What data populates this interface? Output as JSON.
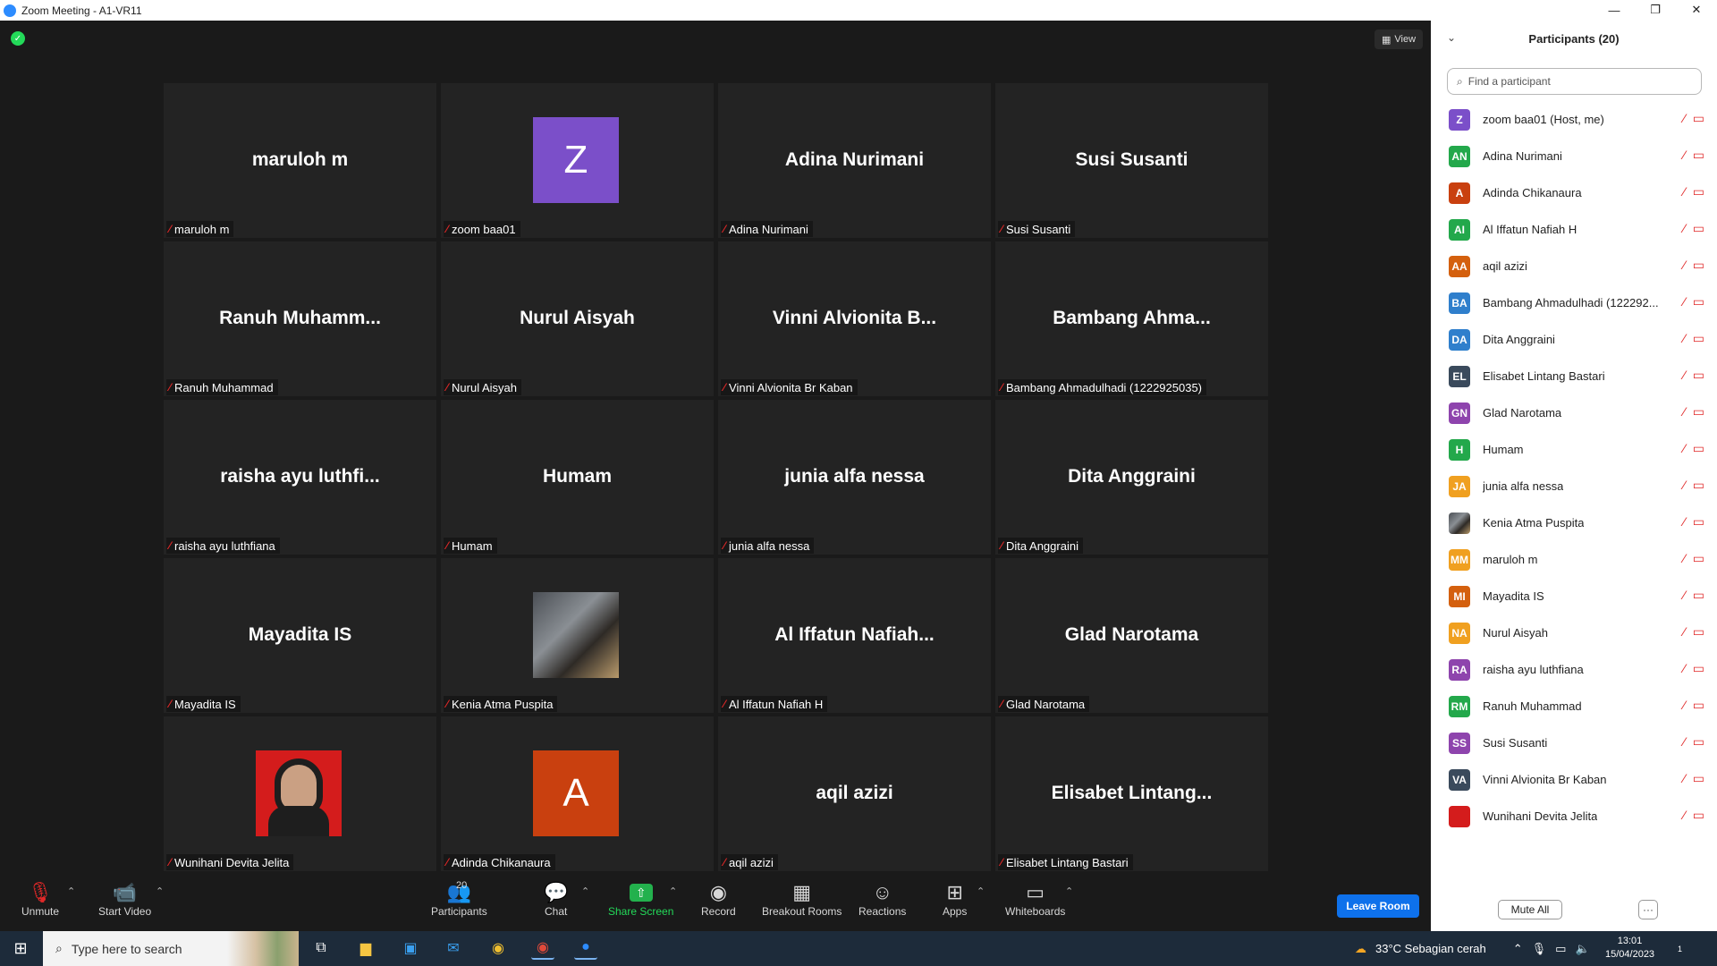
{
  "window": {
    "title": "Zoom Meeting - A1-VR11",
    "minimize": "—",
    "restore": "❐",
    "close": "✕"
  },
  "stage": {
    "view_label": "View"
  },
  "tiles": [
    {
      "big": "maruloh m",
      "label": "maruloh m"
    },
    {
      "avatar_letter": "Z",
      "avatar_color": "#7b4fc9",
      "label": "zoom baa01"
    },
    {
      "big": "Adina Nurimani",
      "label": "Adina Nurimani"
    },
    {
      "big": "Susi Susanti",
      "label": "Susi Susanti"
    },
    {
      "big": "Ranuh  Muhamm...",
      "label": "Ranuh Muhammad"
    },
    {
      "big": "Nurul Aisyah",
      "label": "Nurul Aisyah"
    },
    {
      "big": "Vinni  Alvionita  B...",
      "label": "Vinni Alvionita Br Kaban"
    },
    {
      "big": "Bambang  Ahma...",
      "label": "Bambang Ahmadulhadi (1222925035)"
    },
    {
      "big": "raisha  ayu  luthfi...",
      "label": "raisha ayu luthfiana"
    },
    {
      "big": "Humam",
      "label": "Humam"
    },
    {
      "big": "junia alfa nessa",
      "label": "junia alfa nessa"
    },
    {
      "big": "Dita Anggraini",
      "label": "Dita Anggraini"
    },
    {
      "big": "Mayadita IS",
      "label": "Mayadita IS"
    },
    {
      "photo": "kenia",
      "label": "Kenia Atma Puspita"
    },
    {
      "big": "Al  Iffatun  Nafiah...",
      "label": "Al Iffatun Nafiah H"
    },
    {
      "big": "Glad Narotama",
      "label": "Glad Narotama"
    },
    {
      "photo": "wunihani",
      "label": "Wunihani Devita Jelita"
    },
    {
      "avatar_letter": "A",
      "avatar_color": "#c9400f",
      "label": "Adinda Chikanaura"
    },
    {
      "big": "aqil azizi",
      "label": "aqil azizi"
    },
    {
      "big": "Elisabet  Lintang...",
      "label": "Elisabet Lintang Bastari"
    }
  ],
  "toolbar": {
    "unmute": "Unmute",
    "start_video": "Start Video",
    "participants": "Participants",
    "participants_count": "20",
    "chat": "Chat",
    "share_screen": "Share Screen",
    "record": "Record",
    "breakout_rooms": "Breakout Rooms",
    "reactions": "Reactions",
    "apps": "Apps",
    "whiteboards": "Whiteboards",
    "leave_room": "Leave Room"
  },
  "panel": {
    "title": "Participants (20)",
    "search_placeholder": "Find a participant",
    "mute_all": "Mute All",
    "more": "···",
    "participants": [
      {
        "initials": "Z",
        "color": "#7b4fc9",
        "name": "zoom baa01 (Host, me)"
      },
      {
        "initials": "AN",
        "color": "#23a84b",
        "name": "Adina Nurimani"
      },
      {
        "initials": "A",
        "color": "#c9400f",
        "name": "Adinda Chikanaura"
      },
      {
        "initials": "AI",
        "color": "#23a84b",
        "name": "Al Iffatun Nafiah H"
      },
      {
        "initials": "AA",
        "color": "#d4600e",
        "name": "aqil azizi"
      },
      {
        "initials": "BA",
        "color": "#2f7fcc",
        "name": "Bambang Ahmadulhadi (122292..."
      },
      {
        "initials": "DA",
        "color": "#2f7fcc",
        "name": "Dita Anggraini"
      },
      {
        "initials": "EL",
        "color": "#3a4a5c",
        "name": "Elisabet Lintang Bastari"
      },
      {
        "initials": "GN",
        "color": "#8e44ad",
        "name": "Glad Narotama"
      },
      {
        "initials": "H",
        "color": "#23a84b",
        "name": "Humam"
      },
      {
        "initials": "JA",
        "color": "#f0a020",
        "name": "junia alfa nessa"
      },
      {
        "photo": "kenia",
        "name": "Kenia Atma Puspita"
      },
      {
        "initials": "MM",
        "color": "#f0a020",
        "name": "maruloh m"
      },
      {
        "initials": "MI",
        "color": "#d4600e",
        "name": "Mayadita IS"
      },
      {
        "initials": "NA",
        "color": "#f0a020",
        "name": "Nurul Aisyah"
      },
      {
        "initials": "RA",
        "color": "#8e44ad",
        "name": "raisha ayu luthfiana"
      },
      {
        "initials": "RM",
        "color": "#23a84b",
        "name": "Ranuh Muhammad"
      },
      {
        "initials": "SS",
        "color": "#8e44ad",
        "name": "Susi Susanti"
      },
      {
        "initials": "VA",
        "color": "#3a4a5c",
        "name": "Vinni Alvionita Br Kaban"
      },
      {
        "photo": "wunihani",
        "name": "Wunihani Devita Jelita"
      }
    ]
  },
  "taskbar": {
    "search_placeholder": "Type here to search",
    "weather": "33°C  Sebagian cerah",
    "time": "13:01",
    "date": "15/04/2023",
    "notification_count": "1"
  }
}
